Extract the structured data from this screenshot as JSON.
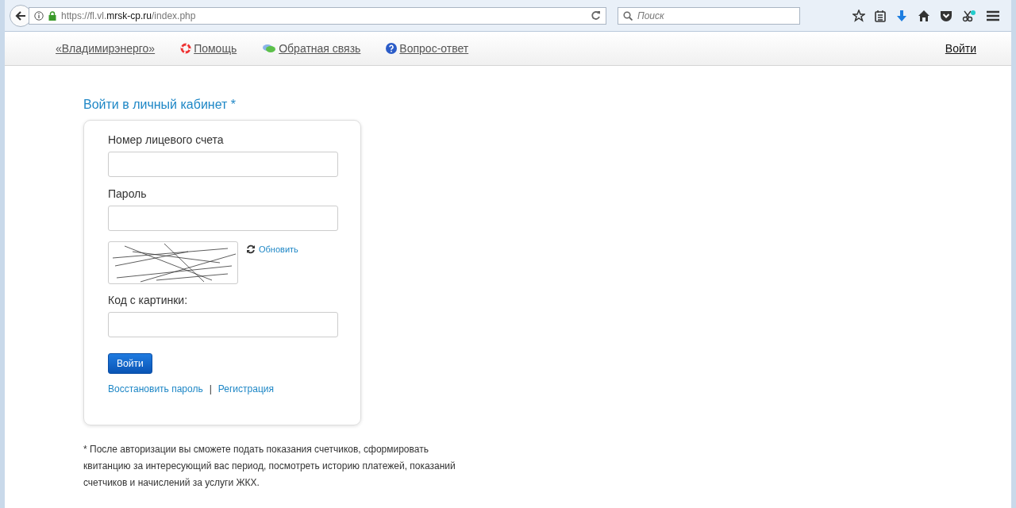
{
  "browser": {
    "url": "https://fl.vl.**mrsk-cp.ru**/index.php",
    "search": {
      "placeholder": "Поиск"
    }
  },
  "nav": {
    "links": [
      {
        "label": "«Владимирэнерго»",
        "kind": "plain"
      },
      {
        "label": "Помощь",
        "kind": "help"
      },
      {
        "label": "Обратная связь",
        "kind": "feedback"
      },
      {
        "label": "Вопрос-ответ",
        "kind": "faq"
      }
    ],
    "login": "Войти"
  },
  "login_form": {
    "title": "Войти в личный кабинет *",
    "fields": [
      {
        "label": "Номер лицевого счета"
      },
      {
        "label": "Пароль"
      }
    ],
    "captcha": {
      "refresh": "Обновить",
      "label": "Код с картинки:"
    },
    "submit": "Войти",
    "links": [
      "Восстановить пароль",
      "Регистрация"
    ],
    "separator": "|"
  },
  "footnote": "* После авторизации вы сможете подать показания счетчиков, сформировать квитанцию за интересующий вас период, посмотреть историю платежей, показаний счетчиков и начислений за услуги ЖКХ."
}
